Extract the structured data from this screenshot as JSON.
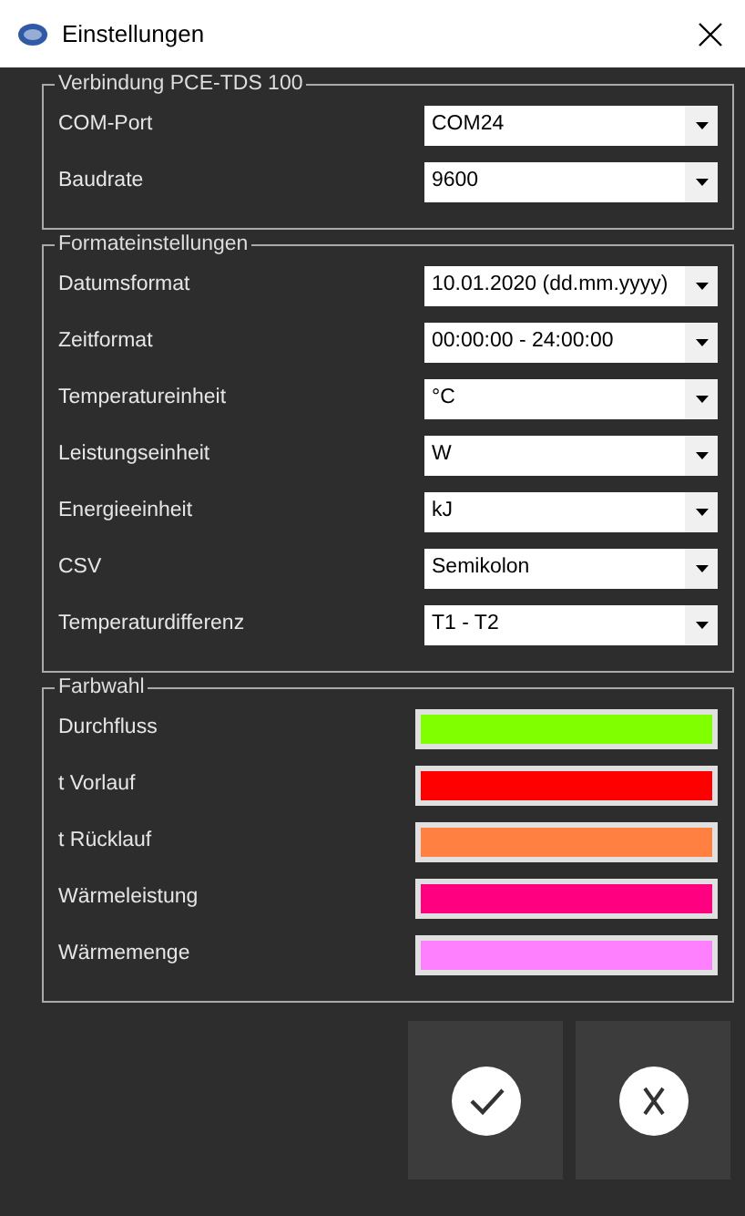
{
  "window": {
    "title": "Einstellungen"
  },
  "groups": [
    {
      "title": "Verbindung PCE-TDS 100",
      "kind": "combo",
      "rows": [
        {
          "label": "COM-Port",
          "value": "COM24"
        },
        {
          "label": "Baudrate",
          "value": "9600"
        }
      ]
    },
    {
      "title": "Formateinstellungen",
      "kind": "combo",
      "rows": [
        {
          "label": "Datumsformat",
          "value": "10.01.2020 (dd.mm.yyyy)"
        },
        {
          "label": "Zeitformat",
          "value": "00:00:00 - 24:00:00"
        },
        {
          "label": "Temperatureinheit",
          "value": "°C"
        },
        {
          "label": "Leistungseinheit",
          "value": "W"
        },
        {
          "label": "Energieeinheit",
          "value": "kJ"
        },
        {
          "label": "CSV",
          "value": "Semikolon"
        },
        {
          "label": "Temperaturdifferenz",
          "value": "T1 - T2"
        }
      ]
    },
    {
      "title": "Farbwahl",
      "kind": "color",
      "rows": [
        {
          "label": "Durchfluss",
          "color": "#80ff00"
        },
        {
          "label": "t Vorlauf",
          "color": "#ff0000"
        },
        {
          "label": "t Rücklauf",
          "color": "#ff8040"
        },
        {
          "label": "Wärmeleistung",
          "color": "#ff0080"
        },
        {
          "label": "Wärmemenge",
          "color": "#ff80ff"
        }
      ]
    }
  ],
  "buttons": [
    {
      "kind": "ok"
    },
    {
      "kind": "cancel"
    }
  ]
}
